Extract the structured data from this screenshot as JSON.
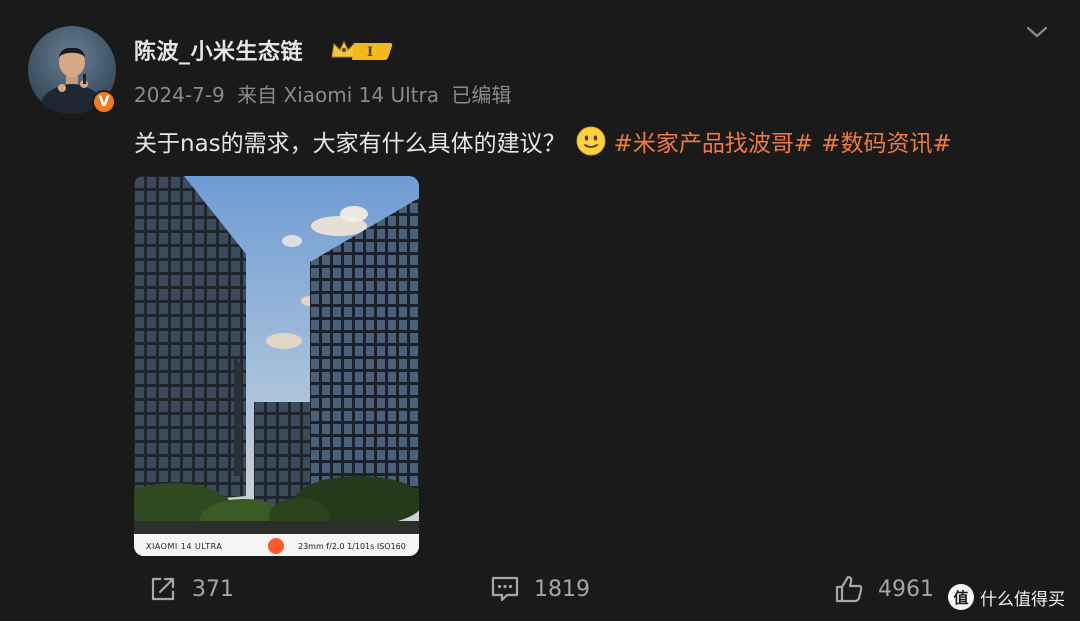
{
  "post": {
    "author": "陈波_小米生态链",
    "level_badge": "I",
    "date": "2024-7-9",
    "source": "来自 Xiaomi 14 Ultra",
    "edited": "已编辑",
    "text": "关于nas的需求，大家有什么具体的建议？",
    "hashtags": [
      "#米家产品找波哥#",
      "#数码资讯#"
    ]
  },
  "photo": {
    "watermark_brand": "XIAOMI 14 ULTRA",
    "watermark_specs": "23mm  f/2.0  1/101s  ISO160"
  },
  "actions": {
    "repost_count": "371",
    "comment_count": "1819",
    "like_count": "4961"
  },
  "site_watermark": {
    "logo_char": "值",
    "text": "什么值得买"
  },
  "icons": {
    "verified": "verified-v-icon",
    "crown": "crown-icon",
    "expand": "chevron-down-icon",
    "emoji": "smile-emoji-icon",
    "repost": "repost-icon",
    "comment": "comment-icon",
    "like": "thumbs-up-icon"
  },
  "colors": {
    "background": "#1a1a1a",
    "hashtag": "#f07a3a",
    "verified": "#f07a1b",
    "badge_gold": "#f2b81c"
  }
}
